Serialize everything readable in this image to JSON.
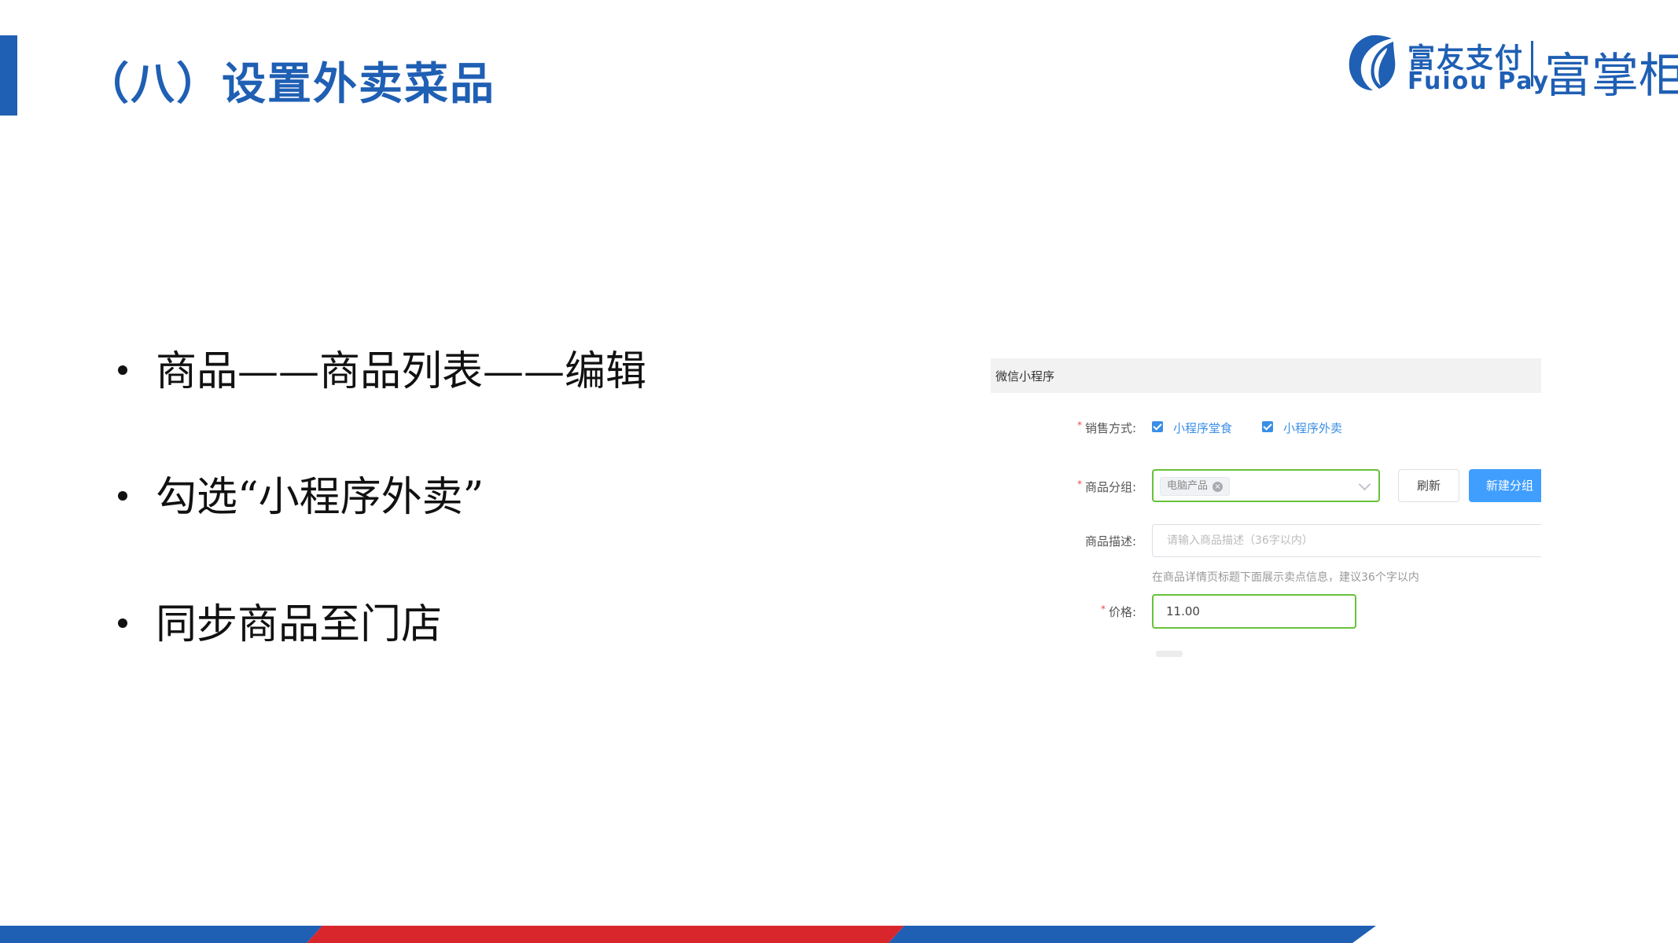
{
  "slide": {
    "title": "（八）设置外卖菜品"
  },
  "logo": {
    "cn": "富友支付",
    "en": "Fuiou Pay",
    "brand": "富掌柜"
  },
  "bullets": [
    "商品——商品列表——编辑",
    "勾选“小程序外卖”",
    "同步商品至门店"
  ],
  "screenshot": {
    "section_title": "微信小程序",
    "sales_method": {
      "label": "销售方式:",
      "options": [
        {
          "label": "小程序堂食",
          "checked": true
        },
        {
          "label": "小程序外卖",
          "checked": true
        }
      ]
    },
    "product_group": {
      "label": "商品分组:",
      "selected_tag": "电脑产品",
      "refresh_label": "刷新",
      "new_group_label": "新建分组"
    },
    "description": {
      "label": "商品描述:",
      "placeholder": "请输入商品描述（36字以内）",
      "hint": "在商品详情页标题下面展示卖点信息，建议36个字以内"
    },
    "price": {
      "label": "价格:",
      "value": "11.00"
    }
  },
  "colors": {
    "primary_blue": "#1f5fb4",
    "footer_red": "#d9262c",
    "button_blue": "#409eff",
    "valid_green": "#67c23a"
  }
}
